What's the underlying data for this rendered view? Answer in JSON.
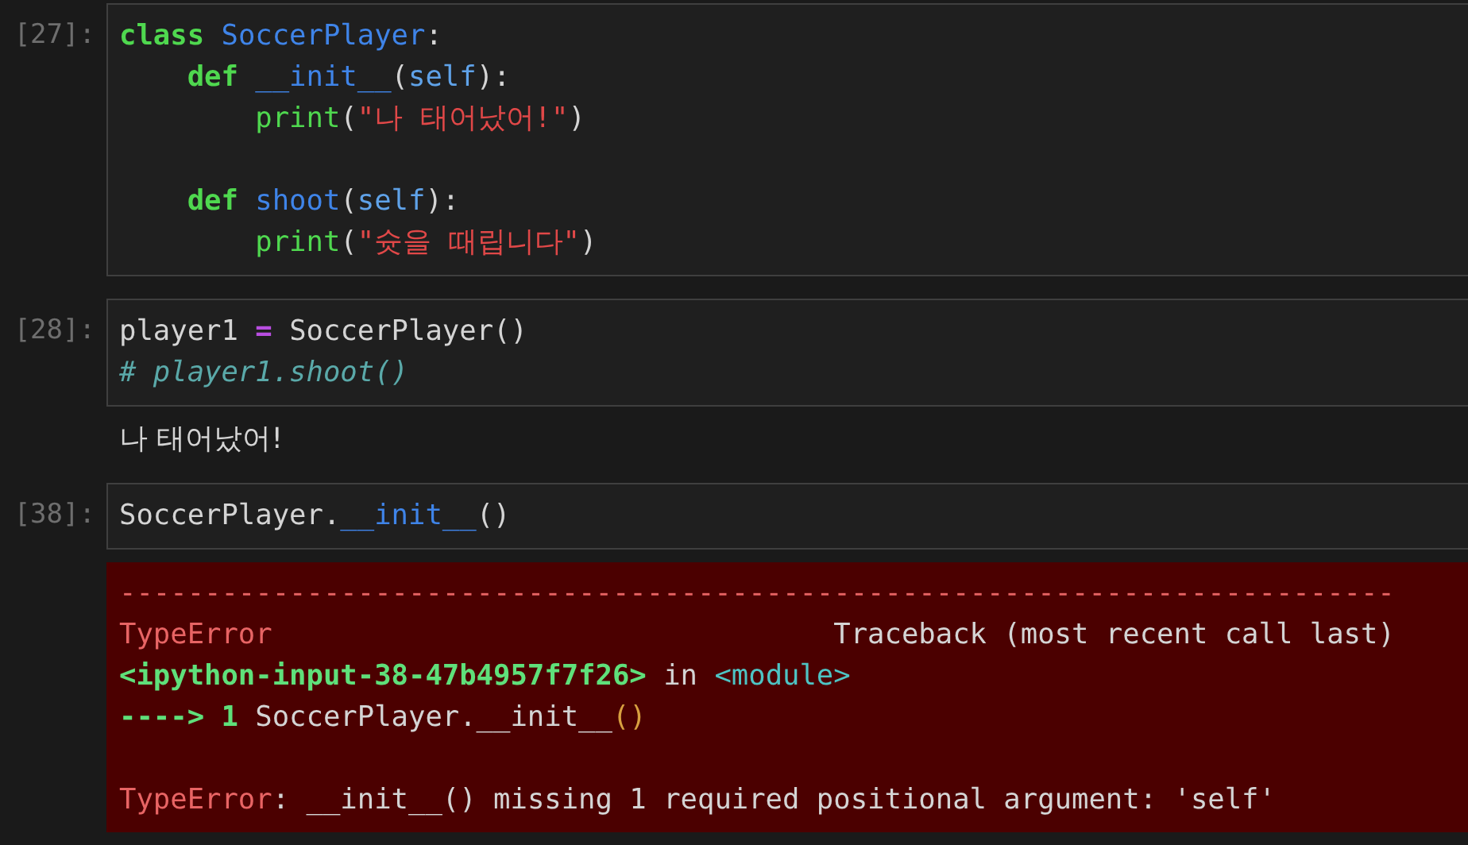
{
  "cells": [
    {
      "prompt": "[27]:",
      "lines": [
        {
          "tokens": [
            {
              "text": "class",
              "kind": "keyword"
            },
            {
              "text": " SoccerPlayer",
              "kind": "name"
            },
            {
              "text": ":",
              "kind": "text"
            }
          ]
        },
        {
          "tokens": [
            {
              "text": "    def",
              "kind": "keyword"
            },
            {
              "text": " __init__",
              "kind": "name"
            },
            {
              "text": "(",
              "kind": "text"
            },
            {
              "text": "self",
              "kind": "param"
            },
            {
              "text": "):",
              "kind": "text"
            }
          ]
        },
        {
          "tokens": [
            {
              "text": "        print",
              "kind": "builtin"
            },
            {
              "text": "(",
              "kind": "text"
            },
            {
              "text": "\"나 태어났어!\"",
              "kind": "string"
            },
            {
              "text": ")",
              "kind": "text"
            }
          ]
        },
        {
          "kind": "blank"
        },
        {
          "tokens": [
            {
              "text": "    def",
              "kind": "keyword"
            },
            {
              "text": " shoot",
              "kind": "name"
            },
            {
              "text": "(",
              "kind": "text"
            },
            {
              "text": "self",
              "kind": "param"
            },
            {
              "text": "):",
              "kind": "text"
            }
          ]
        },
        {
          "tokens": [
            {
              "text": "        print",
              "kind": "builtin"
            },
            {
              "text": "(",
              "kind": "text"
            },
            {
              "text": "\"슛을 때립니다\"",
              "kind": "string"
            },
            {
              "text": ")",
              "kind": "text"
            }
          ]
        }
      ]
    },
    {
      "prompt": "[28]:",
      "lines": [
        {
          "tokens": [
            {
              "text": "player1 ",
              "kind": "text"
            },
            {
              "text": "=",
              "kind": "operator"
            },
            {
              "text": " SoccerPlayer()",
              "kind": "text"
            }
          ]
        },
        {
          "tokens": [
            {
              "text": "# player1.shoot()",
              "kind": "comment"
            }
          ]
        }
      ],
      "output": {
        "kind": "text",
        "text": "나 태어났어!"
      }
    },
    {
      "prompt": "[38]:",
      "lines": [
        {
          "tokens": [
            {
              "text": "SoccerPlayer.",
              "kind": "text"
            },
            {
              "text": "__init__",
              "kind": "name"
            },
            {
              "text": "()",
              "kind": "text"
            }
          ]
        }
      ],
      "output": {
        "kind": "error",
        "lines": [
          {
            "tokens": [
              {
                "text": "---------------------------------------------------------------------------",
                "kind": "error"
              }
            ]
          },
          {
            "tokens": [
              {
                "text": "TypeError",
                "kind": "error"
              },
              {
                "text": "                                 Traceback (most recent call last)",
                "kind": "text"
              }
            ]
          },
          {
            "tokens": [
              {
                "text": "<ipython-input-38-47b4957f7f26>",
                "kind": "location"
              },
              {
                "text": " in ",
                "kind": "text"
              },
              {
                "text": "<module>",
                "kind": "module"
              }
            ]
          },
          {
            "tokens": [
              {
                "text": "----> 1",
                "kind": "arrow"
              },
              {
                "text": " SoccerPlayer.__init__",
                "kind": "text"
              },
              {
                "text": "()",
                "kind": "highlight"
              }
            ]
          },
          {
            "kind": "blank"
          },
          {
            "tokens": [
              {
                "text": "TypeError",
                "kind": "error"
              },
              {
                "text": ": __init__() missing 1 required positional argument: 'self'",
                "kind": "text"
              }
            ]
          }
        ]
      }
    }
  ]
}
